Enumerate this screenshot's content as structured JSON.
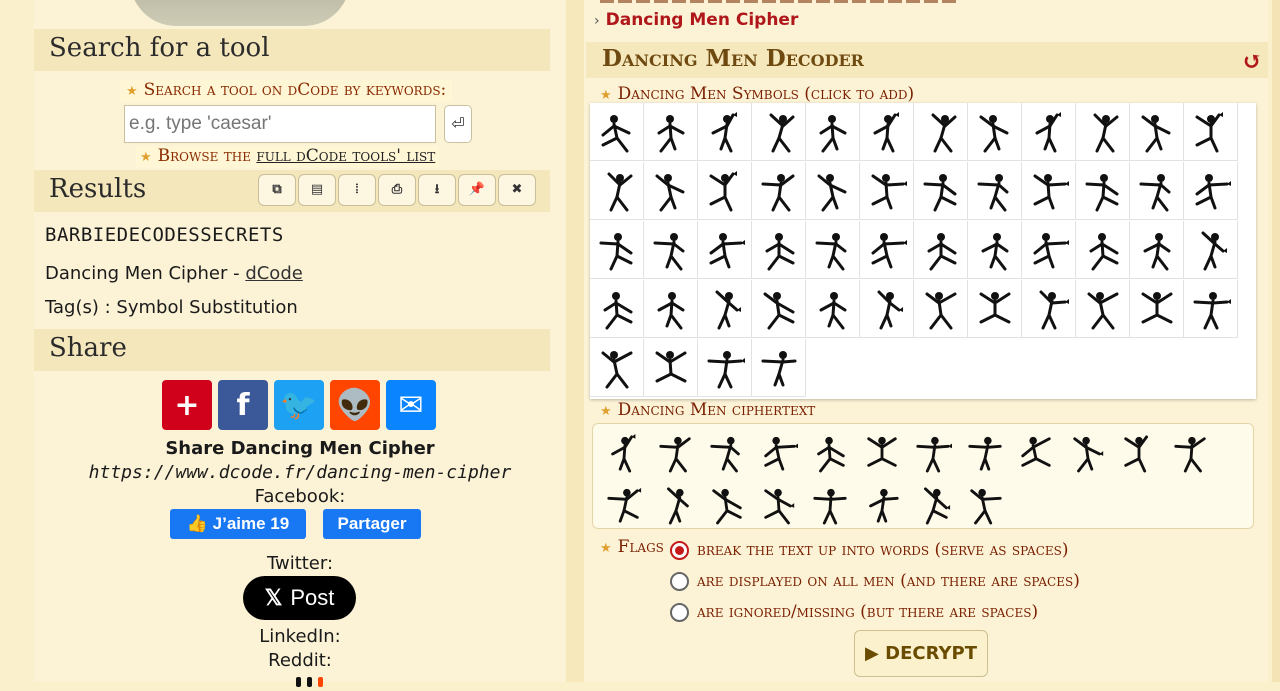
{
  "left": {
    "search_section_title": "Search for a tool",
    "search_label": "Search a tool on dCode by keywords:",
    "search_placeholder": "e.g. type 'caesar'",
    "search_go_icon": "enter-icon",
    "browse_prefix": "Browse the ",
    "browse_link": "full dCode tools' list",
    "results_title": "Results",
    "toolbar_icons": [
      "copy-icon",
      "paste-icon",
      "columns-icon",
      "print-icon",
      "download-icon",
      "pin-icon",
      "close-icon"
    ],
    "toolbar_glyphs": [
      "⧉",
      "▤",
      "⦙",
      "⎙",
      "⭳",
      "📌",
      "✖"
    ],
    "result_value": "BARBIEDECODESSECRETS",
    "result_source_prefix": "Dancing Men Cipher - ",
    "result_source_link": "dCode",
    "result_tags": "Tag(s) : Symbol Substitution",
    "share_title": "Share",
    "share_icons": [
      {
        "name": "share-add-icon",
        "glyph": "+",
        "color": "#d0021b"
      },
      {
        "name": "facebook-icon",
        "glyph": "f",
        "color": "#3b5998"
      },
      {
        "name": "twitter-icon",
        "glyph": "🐦",
        "color": "#1da1f2"
      },
      {
        "name": "reddit-icon",
        "glyph": "👽",
        "color": "#ff4500"
      },
      {
        "name": "email-icon",
        "glyph": "✉",
        "color": "#0a84ff"
      }
    ],
    "share_heading": "Share Dancing Men Cipher",
    "share_url": "https://www.dcode.fr/dancing-men-cipher",
    "facebook_label": "Facebook:",
    "fb_like": "J’aime 19",
    "fb_share": "Partager",
    "twitter_label": "Twitter:",
    "x_post": "Post",
    "linkedin_label": "LinkedIn:",
    "reddit_label": "Reddit:"
  },
  "right": {
    "breadcrumb": "Dancing Men Cipher",
    "decoder_title": "Dancing Men Decoder",
    "reload_icon": "reload-icon",
    "symbols_label": "Dancing Men Symbols (click to add)",
    "symbols_count": 52,
    "ciphertext_label": "Dancing Men ciphertext",
    "ciphertext_row1_count": 12,
    "ciphertext_row2_count": 8,
    "flags_label": "Flags",
    "flag_options": [
      {
        "label": "break the text up into words (serve as spaces)",
        "selected": true
      },
      {
        "label": "are displayed on all men (and there are spaces)",
        "selected": false
      },
      {
        "label": "are ignored/missing (but there are spaces)",
        "selected": false
      }
    ],
    "decrypt_label": "▶ DECRYPT"
  }
}
